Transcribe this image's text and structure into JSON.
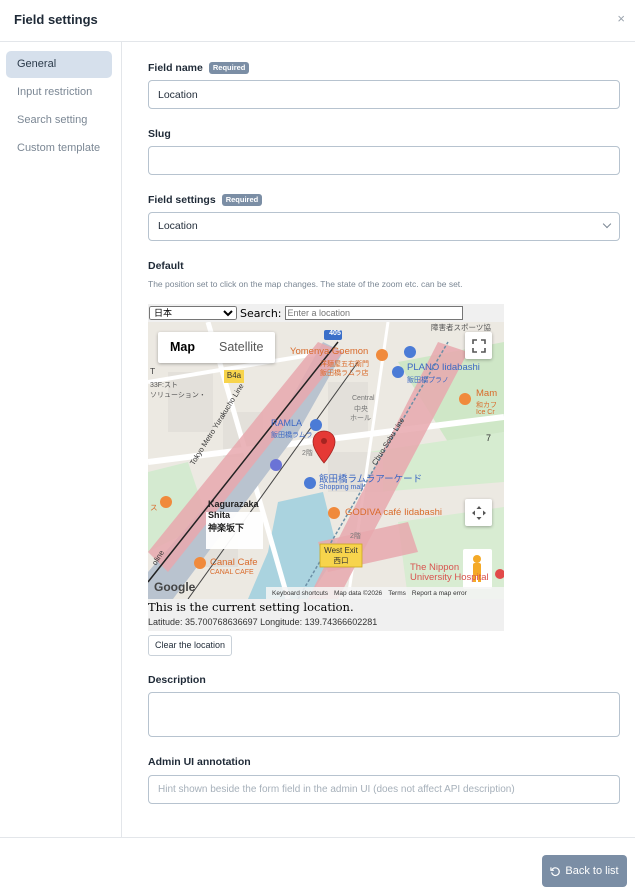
{
  "header": {
    "title": "Field settings",
    "close": "×"
  },
  "sidebar": {
    "items": [
      {
        "label": "General"
      },
      {
        "label": "Input restriction"
      },
      {
        "label": "Search setting"
      },
      {
        "label": "Custom template"
      }
    ]
  },
  "form": {
    "field_name": {
      "label": "Field name",
      "badge": "Required",
      "value": "Location"
    },
    "slug": {
      "label": "Slug",
      "value": ""
    },
    "field_settings": {
      "label": "Field settings",
      "badge": "Required",
      "value": "Location"
    },
    "default": {
      "label": "Default",
      "hint": "The position set to click on the map changes. The state of the zoom etc. can be set."
    },
    "description": {
      "label": "Description",
      "value": ""
    },
    "admin_annotation": {
      "label": "Admin UI annotation",
      "placeholder": "Hint shown beside the form field in the admin UI (does not affect API description)"
    }
  },
  "map": {
    "country_select": "日本",
    "search_label": "Search:",
    "search_placeholder": "Enter a location",
    "type_map": "Map",
    "type_satellite": "Satellite",
    "caption": "This is the current setting location.",
    "coords": "Latitude: 35.700768636697 Longitude: 139.74366602281",
    "footer_keyboard": "Keyboard shortcuts",
    "footer_data": "Map data ©2026",
    "footer_terms": "Terms",
    "footer_report": "Report a map error",
    "google_logo": "Google",
    "labels": {
      "top_right_jp": "障害者スポーツ協",
      "route_405": "405",
      "yomenya": "Yomenya Goemon",
      "yomenya_jp1": "洋麺屋五右衛門",
      "yomenya_jp2": "飯田橋ラムラ店",
      "plano": "PLANO Iidabashi",
      "plano_jp": "飯田橋プラノ",
      "mam": "Mam",
      "mam_jp": "和カフ",
      "ice": "Ice Cr",
      "b4a": "B4a",
      "ramla": "RAMLA",
      "ramla_jp": "飯田橋ラムラ",
      "central": "Central",
      "plaza": "中央",
      "hall": "ホール",
      "floor2f": "2階",
      "tokyo_metro": "Tokyo Metro Yurakucho Line",
      "chuo_sobu": "Chuo-Sobu Line",
      "ramla_arcade": "飯田橋ラムラアーケード",
      "shopping_mall": "Shopping mall",
      "kagurazaka1": "Kagurazaka",
      "kagurazaka2": "Shita",
      "kagurazaka_jp": "神楽坂下",
      "godiva": "GODIVA café Iidabashi",
      "floor2f_b": "2階",
      "west_exit": "West Exit",
      "west_exit_jp": "西口",
      "canal": "Canal Cafe",
      "canal_sub": "CANAL CAFE",
      "nippon1": "The Nippon",
      "nippon2": "University Hospital",
      "left_t": "T",
      "left_335": "33F:スト",
      "left_sol": "ソリューション・",
      "num7": "7",
      "left_wa": "ス",
      "left_line": "oline"
    }
  },
  "clear_button": "Clear the location",
  "footer": {
    "back_label": "Back to list"
  }
}
